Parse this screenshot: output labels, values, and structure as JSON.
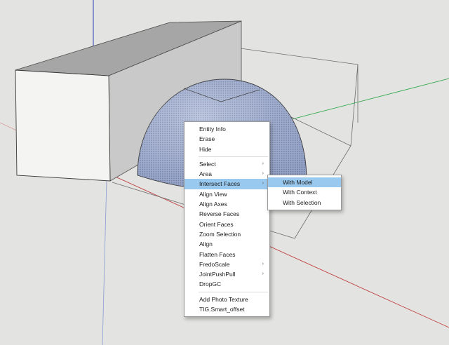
{
  "scene": {
    "background_color": "#e3e3e1",
    "box_front_color": "#f4f4f2",
    "box_top_color": "#a6a6a6",
    "dome_color": "#a8b6d6",
    "axis_colors": {
      "blue": "#2a3fb0",
      "red": "#c04040",
      "green": "#2fa84a"
    }
  },
  "context_menu": {
    "group1": [
      {
        "label": "Entity Info"
      },
      {
        "label": "Erase"
      },
      {
        "label": "Hide"
      }
    ],
    "group2": [
      {
        "label": "Select",
        "submenu": true
      },
      {
        "label": "Area",
        "submenu": true
      },
      {
        "label": "Intersect Faces",
        "submenu": true,
        "highlighted": true
      },
      {
        "label": "Align View"
      },
      {
        "label": "Align Axes"
      },
      {
        "label": "Reverse Faces"
      },
      {
        "label": "Orient Faces"
      },
      {
        "label": "Zoom Selection"
      },
      {
        "label": "Align"
      },
      {
        "label": "Flatten Faces"
      },
      {
        "label": "FredoScale",
        "submenu": true
      },
      {
        "label": "JointPushPull",
        "submenu": true
      },
      {
        "label": "DropGC"
      }
    ],
    "group3": [
      {
        "label": "Add Photo Texture"
      },
      {
        "label": "TIG.Smart_offset"
      }
    ],
    "submenu_arrow": "›"
  },
  "submenu": {
    "items": [
      {
        "label": "With Model",
        "highlighted": true
      },
      {
        "label": "With Context"
      },
      {
        "label": "With Selection"
      }
    ]
  }
}
